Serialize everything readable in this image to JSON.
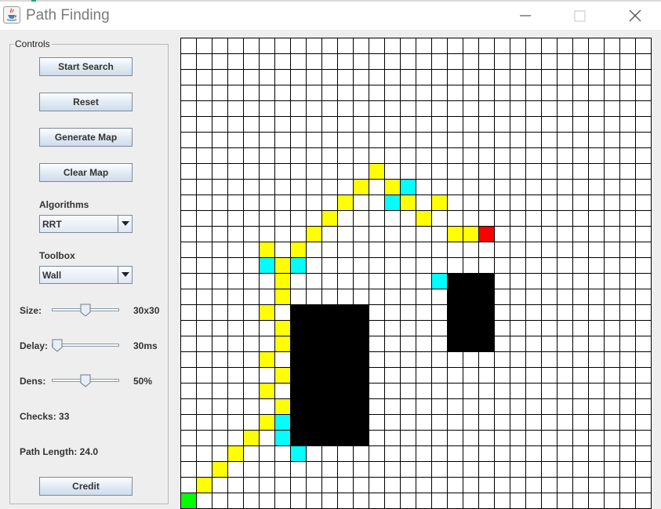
{
  "window": {
    "title": "Path Finding",
    "controls": {
      "minimize": "minimize",
      "maximize": "maximize",
      "close": "close"
    }
  },
  "controls": {
    "legend": "Controls",
    "buttons": {
      "start_search": "Start Search",
      "reset": "Reset",
      "generate_map": "Generate Map",
      "clear_map": "Clear Map",
      "credit": "Credit"
    },
    "algorithms": {
      "label": "Algorithms",
      "selected": "RRT"
    },
    "toolbox": {
      "label": "Toolbox",
      "selected": "Wall"
    },
    "size": {
      "label": "Size:",
      "value_text": "30x30",
      "slider_fraction": 0.5
    },
    "delay": {
      "label": "Delay:",
      "value_text": "30ms",
      "slider_fraction": 0.0
    },
    "density": {
      "label": "Dens:",
      "value_text": "50%",
      "slider_fraction": 0.5
    },
    "checks": {
      "text": "Checks: 33"
    },
    "path_length": {
      "text": "Path Length: 24.0"
    }
  },
  "grid": {
    "rows": 30,
    "cols": 30,
    "colors": {
      "empty": "#ffffff",
      "wall": "#000000",
      "path": "#ffff00",
      "checked": "#00ffff",
      "start": "#00ff00",
      "finish": "#ff0000",
      "line": "#000000"
    },
    "start": [
      0,
      29
    ],
    "finish": [
      19,
      12
    ],
    "walls": [
      [
        7,
        17,
        5,
        9
      ],
      [
        17,
        15,
        3,
        5
      ]
    ],
    "path": [
      [
        1,
        28
      ],
      [
        2,
        27
      ],
      [
        3,
        26
      ],
      [
        4,
        25
      ],
      [
        5,
        24
      ],
      [
        5,
        22
      ],
      [
        6,
        23
      ],
      [
        5,
        20
      ],
      [
        6,
        21
      ],
      [
        6,
        19
      ],
      [
        6,
        18
      ],
      [
        5,
        17
      ],
      [
        6,
        16
      ],
      [
        6,
        15
      ],
      [
        6,
        14
      ],
      [
        5,
        13
      ],
      [
        7,
        13
      ],
      [
        8,
        12
      ],
      [
        9,
        11
      ],
      [
        10,
        10
      ],
      [
        11,
        9
      ],
      [
        12,
        8
      ],
      [
        13,
        9
      ],
      [
        14,
        10
      ],
      [
        15,
        11
      ],
      [
        16,
        10
      ],
      [
        17,
        12
      ],
      [
        18,
        12
      ]
    ],
    "checked": [
      [
        5,
        14
      ],
      [
        6,
        15
      ],
      [
        7,
        14
      ],
      [
        6,
        24
      ],
      [
        6,
        25
      ],
      [
        7,
        26
      ],
      [
        13,
        10
      ],
      [
        14,
        9
      ],
      [
        16,
        15
      ]
    ]
  }
}
